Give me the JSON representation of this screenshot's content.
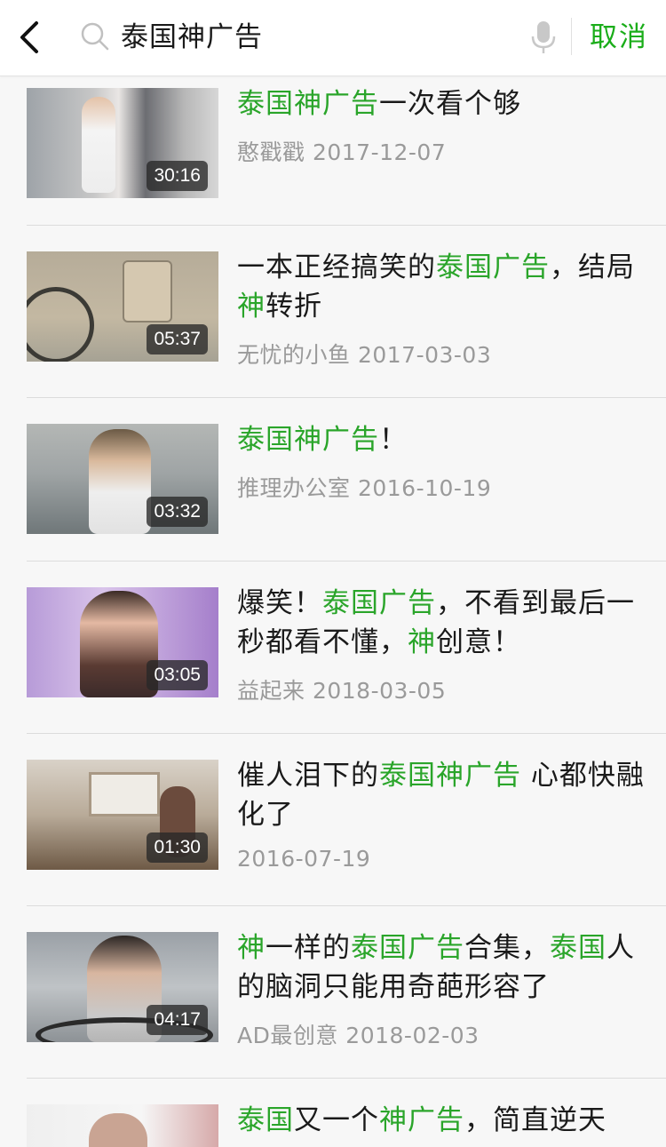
{
  "header": {
    "search_query": "泰国神广告",
    "cancel_label": "取消",
    "accent_color": "#1aad19"
  },
  "results": [
    {
      "title": [
        {
          "t": "泰国神广告",
          "hl": true
        },
        {
          "t": "一次看个够",
          "hl": false
        }
      ],
      "author": "憨戳戳",
      "date": "2017-12-07",
      "duration": "30:16",
      "meta": "憨戳戳 2017-12-07"
    },
    {
      "title": [
        {
          "t": "一本正经搞笑的",
          "hl": false
        },
        {
          "t": "泰国广告",
          "hl": true
        },
        {
          "t": "，结局",
          "hl": false
        },
        {
          "t": "神",
          "hl": true
        },
        {
          "t": "转折",
          "hl": false
        }
      ],
      "author": "无忧的小鱼",
      "date": "2017-03-03",
      "duration": "05:37",
      "meta": "无忧的小鱼 2017-03-03"
    },
    {
      "title": [
        {
          "t": "泰国神广告",
          "hl": true
        },
        {
          "t": "！",
          "hl": false
        }
      ],
      "author": "推理办公室",
      "date": "2016-10-19",
      "duration": "03:32",
      "meta": "推理办公室 2016-10-19"
    },
    {
      "title": [
        {
          "t": "爆笑！",
          "hl": false
        },
        {
          "t": "泰国广告",
          "hl": true
        },
        {
          "t": "，不看到最后一秒都看不懂，",
          "hl": false
        },
        {
          "t": "神",
          "hl": true
        },
        {
          "t": "创意！",
          "hl": false
        }
      ],
      "author": "益起来",
      "date": "2018-03-05",
      "duration": "03:05",
      "meta": "益起来 2018-03-05"
    },
    {
      "title": [
        {
          "t": "催人泪下的",
          "hl": false
        },
        {
          "t": "泰国神广告",
          "hl": true
        },
        {
          "t": " 心都快融化了",
          "hl": false
        }
      ],
      "author": "",
      "date": "2016-07-19",
      "duration": "01:30",
      "meta": "2016-07-19"
    },
    {
      "title": [
        {
          "t": "神",
          "hl": true
        },
        {
          "t": "一样的",
          "hl": false
        },
        {
          "t": "泰国广告",
          "hl": true
        },
        {
          "t": "合集，",
          "hl": false
        },
        {
          "t": "泰国",
          "hl": true
        },
        {
          "t": "人的脑洞只能用奇葩形容了",
          "hl": false
        }
      ],
      "author": "AD最创意",
      "date": "2018-02-03",
      "duration": "04:17",
      "meta": "AD最创意 2018-02-03"
    },
    {
      "title": [
        {
          "t": "泰国",
          "hl": true
        },
        {
          "t": "又一个",
          "hl": false
        },
        {
          "t": "神广告",
          "hl": true
        },
        {
          "t": "，简直逆天",
          "hl": false
        }
      ],
      "author": "",
      "date": "",
      "duration": "",
      "meta": ""
    }
  ]
}
